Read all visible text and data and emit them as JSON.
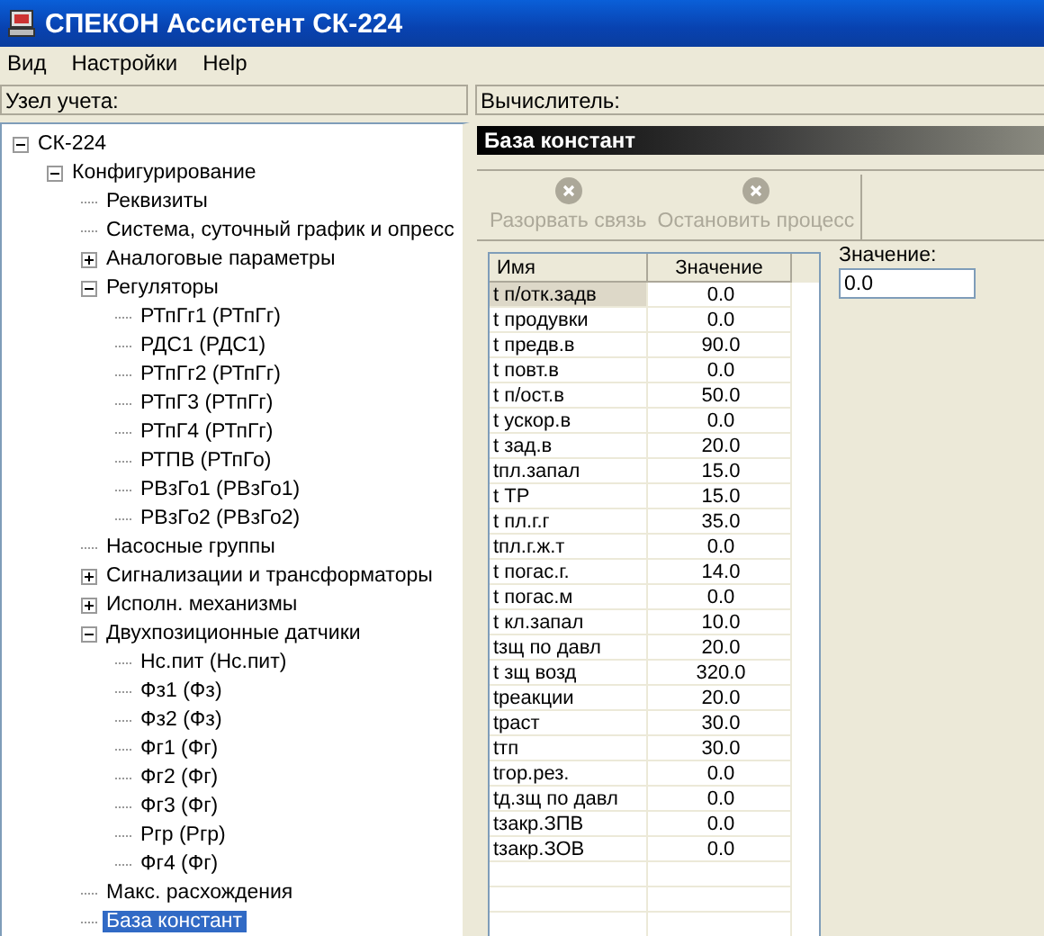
{
  "window": {
    "title": "СПЕКОН Ассистент СК-224"
  },
  "menu": [
    "Вид",
    "Настройки",
    "Help"
  ],
  "left_header": "Узел учета:",
  "right_header": "Вычислитель:",
  "tree": [
    {
      "label": "СК-224",
      "expanded": true,
      "selected": false,
      "children": [
        {
          "label": "Конфигурирование",
          "expanded": true,
          "selected": false,
          "children": [
            {
              "label": "Реквизиты",
              "selected": false
            },
            {
              "label": "Система, суточный график и опресс",
              "selected": false
            },
            {
              "label": "Аналоговые параметры",
              "expanded": false,
              "selected": false
            },
            {
              "label": "Регуляторы",
              "expanded": true,
              "selected": false,
              "children": [
                {
                  "label": "РТпГг1 (РТпГг)",
                  "selected": false
                },
                {
                  "label": "РДС1 (РДС1)",
                  "selected": false
                },
                {
                  "label": "РТпГг2 (РТпГг)",
                  "selected": false
                },
                {
                  "label": "РТпГ3 (РТпГг)",
                  "selected": false
                },
                {
                  "label": "РТпГ4 (РТпГг)",
                  "selected": false
                },
                {
                  "label": "РТПВ (РТпГо)",
                  "selected": false
                },
                {
                  "label": "РВзГо1 (РВзГо1)",
                  "selected": false
                },
                {
                  "label": "РВзГо2 (РВзГо2)",
                  "selected": false
                }
              ]
            },
            {
              "label": "Насосные группы",
              "selected": false
            },
            {
              "label": "Сигнализации и трансформаторы",
              "expanded": false,
              "selected": false
            },
            {
              "label": "Исполн. механизмы",
              "expanded": false,
              "selected": false
            },
            {
              "label": "Двухпозиционные датчики",
              "expanded": true,
              "selected": false,
              "children": [
                {
                  "label": "Нс.пит (Нс.пит)",
                  "selected": false
                },
                {
                  "label": "Фз1 (Фз)",
                  "selected": false
                },
                {
                  "label": "Фз2 (Фз)",
                  "selected": false
                },
                {
                  "label": "Фг1 (Фг)",
                  "selected": false
                },
                {
                  "label": "Фг2 (Фг)",
                  "selected": false
                },
                {
                  "label": "Фг3 (Фг)",
                  "selected": false
                },
                {
                  "label": "Ргр (Ргр)",
                  "selected": false
                },
                {
                  "label": "Фг4 (Фг)",
                  "selected": false
                }
              ]
            },
            {
              "label": "Макс. расхождения",
              "selected": false
            },
            {
              "label": "База констант",
              "selected": true
            }
          ]
        }
      ]
    }
  ],
  "panel": {
    "title": "База констант",
    "toolbar": [
      {
        "label": "Разорвать связь",
        "disabled": true
      },
      {
        "label": "Остановить процесс",
        "disabled": true
      }
    ],
    "table": {
      "columns": [
        "Имя",
        "Значение"
      ],
      "rows": [
        {
          "name": "t п/отк.задв",
          "value": "0.0",
          "selected": true
        },
        {
          "name": "t продувки",
          "value": "0.0",
          "selected": false
        },
        {
          "name": "t предв.в",
          "value": "90.0",
          "selected": false
        },
        {
          "name": "t повт.в",
          "value": "0.0",
          "selected": false
        },
        {
          "name": "t п/ост.в",
          "value": "50.0",
          "selected": false
        },
        {
          "name": "t ускор.в",
          "value": "0.0",
          "selected": false
        },
        {
          "name": "t зад.в",
          "value": "20.0",
          "selected": false
        },
        {
          "name": "tпл.запал",
          "value": "15.0",
          "selected": false
        },
        {
          "name": "t ТР",
          "value": "15.0",
          "selected": false
        },
        {
          "name": "t пл.г.г",
          "value": "35.0",
          "selected": false
        },
        {
          "name": "tпл.г.ж.т",
          "value": "0.0",
          "selected": false
        },
        {
          "name": "t погас.г.",
          "value": "14.0",
          "selected": false
        },
        {
          "name": "t погас.м",
          "value": "0.0",
          "selected": false
        },
        {
          "name": "t кл.запал",
          "value": "10.0",
          "selected": false
        },
        {
          "name": "tзщ по давл",
          "value": "20.0",
          "selected": false
        },
        {
          "name": "t зщ возд",
          "value": "320.0",
          "selected": false
        },
        {
          "name": "tреакции",
          "value": "20.0",
          "selected": false
        },
        {
          "name": "tраст",
          "value": "30.0",
          "selected": false
        },
        {
          "name": "tтп",
          "value": "30.0",
          "selected": false
        },
        {
          "name": "tгор.рез.",
          "value": "0.0",
          "selected": false
        },
        {
          "name": "tд.зщ по давл",
          "value": "0.0",
          "selected": false
        },
        {
          "name": "tзакр.ЗПВ",
          "value": "0.0",
          "selected": false
        },
        {
          "name": "tзакр.ЗОВ",
          "value": "0.0",
          "selected": false
        }
      ]
    },
    "value_field": {
      "label": "Значение:",
      "value": "0.0"
    }
  }
}
